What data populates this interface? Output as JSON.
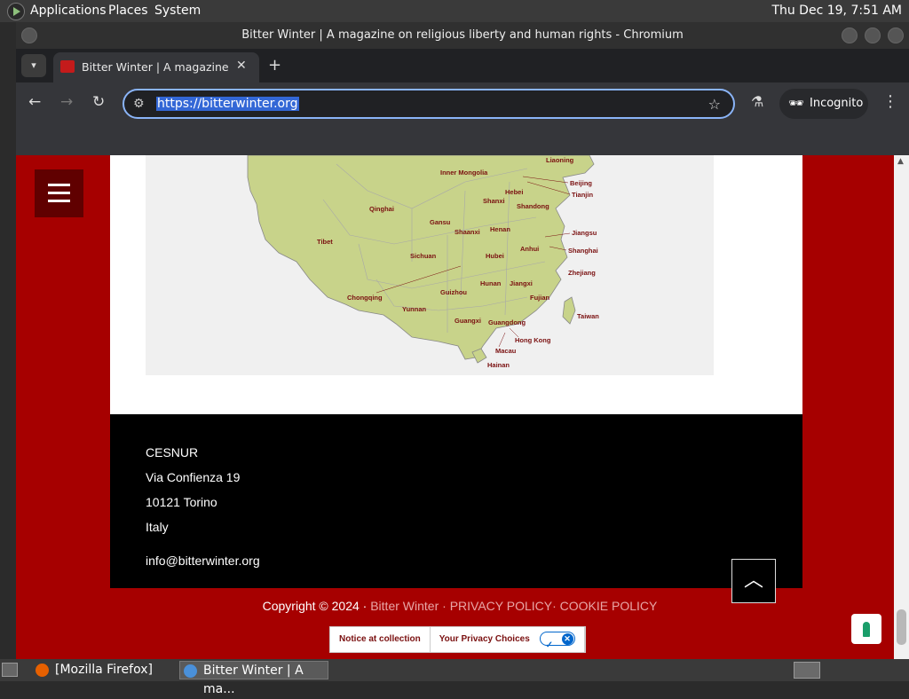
{
  "top_panel": {
    "menus": [
      "Applications",
      "Places",
      "System"
    ],
    "clock": "Thu Dec 19,  7:51 AM"
  },
  "window": {
    "title": "Bitter Winter | A magazine on religious liberty and human rights - Chromium"
  },
  "tab": {
    "title": "Bitter Winter | A magazine on religious liberty and human rights",
    "close_glyph": "✕",
    "new_tab_glyph": "+"
  },
  "toolbar": {
    "url": "https://bitterwinter.org",
    "incognito_label": "Incognito"
  },
  "map": {
    "labels": [
      "Liaoning",
      "Inner Mongolia",
      "Beijing",
      "Tianjin",
      "Hebei",
      "Qinghai",
      "Shanxi",
      "Shandong",
      "Gansu",
      "Tibet",
      "Shaanxi",
      "Henan",
      "Jiangsu",
      "Anhui",
      "Shanghai",
      "Sichuan",
      "Hubei",
      "Zhejiang",
      "Chongqing",
      "Hunan",
      "Jiangxi",
      "Guizhou",
      "Fujian",
      "Yunnan",
      "Taiwan",
      "Guangxi",
      "Guangdong",
      "Hong Kong",
      "Macau",
      "Hainan"
    ]
  },
  "footer": {
    "org": "CESNUR",
    "street": "Via Confienza 19",
    "city": "10121 Torino",
    "country": "Italy",
    "email": "info@bitterwinter.org",
    "copyright_prefix": "Copyright © 2024 ·",
    "site_link": "Bitter Winter",
    "sep1": "·",
    "privacy_link": "PRIVACY POLICY",
    "sep2": "·",
    "cookie_link": "COOKIE POLICY"
  },
  "privacy_bar": {
    "notice": "Notice at collection",
    "choices": "Your Privacy Choices"
  },
  "taskbar": {
    "firefox": "[Mozilla Firefox]",
    "chromium": "Bitter Winter | A ma..."
  },
  "colors": {
    "page_red": "#a60000",
    "accent_blue": "#8ab4f8",
    "map_land": "#c8d38a"
  }
}
